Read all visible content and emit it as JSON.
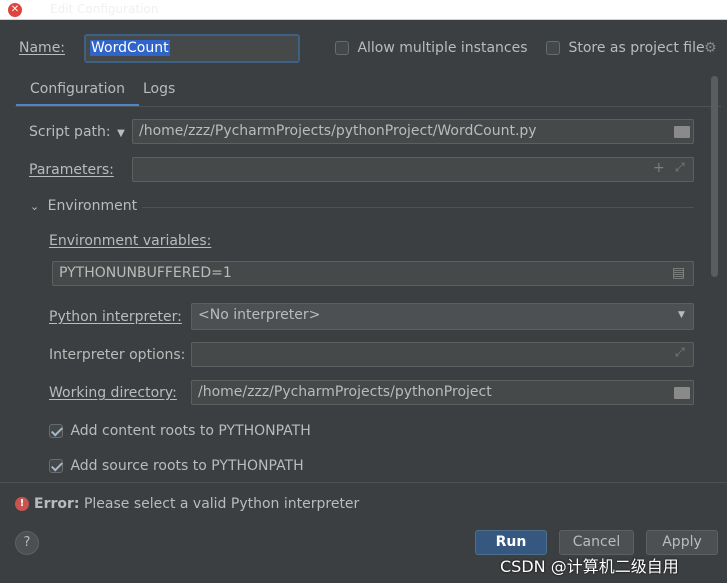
{
  "window": {
    "title": "Edit Configuration"
  },
  "header": {
    "name_label": "Name:",
    "name_value": "WordCount",
    "allow_multiple_label": "Allow multiple instances",
    "store_project_label": "Store as project file"
  },
  "tabs": [
    {
      "label": "Configuration"
    },
    {
      "label": "Logs"
    }
  ],
  "config": {
    "script_path_label": "Script path:",
    "script_path_value": "/home/zzz/PycharmProjects/pythonProject/WordCount.py",
    "parameters_label": "Parameters:",
    "parameters_value": "",
    "environment_section": "Environment",
    "env_vars_label": "Environment variables:",
    "env_vars_value": "PYTHONUNBUFFERED=1",
    "interpreter_label": "Python interpreter:",
    "interpreter_value": "<No interpreter>",
    "interpreter_options_label": "Interpreter options:",
    "interpreter_options_value": "",
    "working_dir_label": "Working directory:",
    "working_dir_value": "/home/zzz/PycharmProjects/pythonProject",
    "content_roots_label": "Add content roots to PYTHONPATH",
    "source_roots_label": "Add source roots to PYTHONPATH"
  },
  "error": {
    "prefix": "Error:",
    "message": "Please select a valid Python interpreter"
  },
  "footer": {
    "help_label": "?",
    "run_label": "Run",
    "cancel_label": "Cancel",
    "apply_label": "Apply"
  },
  "watermark": "CSDN @计算机二级自用",
  "colors": {
    "background": "#3c3f41",
    "field": "#45494a",
    "accent": "#4a88c7",
    "primary_button": "#365880",
    "error": "#c75450"
  }
}
